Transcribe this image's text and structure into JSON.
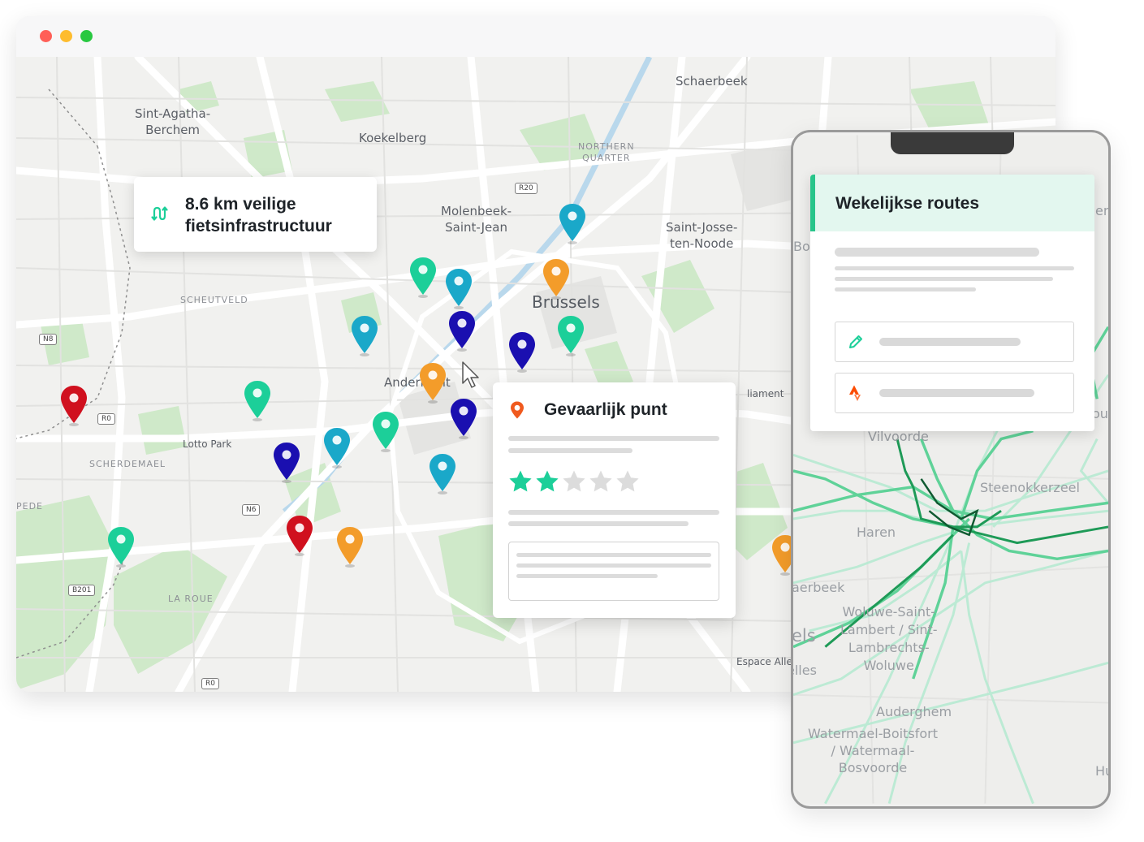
{
  "browser": {
    "controls": [
      "close",
      "minimize",
      "maximize"
    ],
    "map": {
      "labels": [
        {
          "id": "sint-agatha",
          "text": "Sint-Agatha-\nBerchem"
        },
        {
          "id": "koekelberg",
          "text": "Koekelberg"
        },
        {
          "id": "schaerbeek",
          "text": "Schaerbeek"
        },
        {
          "id": "northern-quarter",
          "text": "NORTHERN\nQUARTER"
        },
        {
          "id": "molenbeek",
          "text": "Molenbeek-\nSaint-Jean"
        },
        {
          "id": "saint-josse",
          "text": "Saint-Josse-\nten-Noode"
        },
        {
          "id": "brussels",
          "text": "Brussels"
        },
        {
          "id": "scheutveld",
          "text": "SCHEUTVELD"
        },
        {
          "id": "anderlecht",
          "text": "Anderlecht"
        },
        {
          "id": "lotto-park",
          "text": "Lotto Park"
        },
        {
          "id": "scherdemael",
          "text": "SCHERDEMAEL"
        },
        {
          "id": "la-roue",
          "text": "LA ROUE"
        },
        {
          "id": "pede",
          "text": "PEDE"
        },
        {
          "id": "espace-alle",
          "text": "Espace Alle"
        },
        {
          "id": "liament",
          "text": "liament"
        }
      ],
      "road_shields": [
        "R20",
        "N8",
        "R0",
        "N6",
        "B201",
        "R0"
      ],
      "pins": [
        {
          "color": "#f39c2a",
          "kind": "orange"
        },
        {
          "color": "#1aa8c9",
          "kind": "blue"
        },
        {
          "color": "#1ccf99",
          "kind": "green"
        },
        {
          "color": "#1a0fb0",
          "kind": "navy"
        },
        {
          "color": "#d0101e",
          "kind": "red"
        }
      ]
    },
    "km_card": {
      "line1": "8.6 km veilige",
      "line2": "fietsinfrastructuur",
      "icon": "route-icon",
      "accent": "#1ccf99"
    },
    "danger_card": {
      "title": "Gevaarlijk punt",
      "icon": "location-pin-icon",
      "icon_color": "#f05a1e",
      "rating": 2,
      "rating_max": 5,
      "star_on": "#1ccf99",
      "star_off": "#dcdcdc"
    }
  },
  "phone": {
    "card_title": "Wekelijkse routes",
    "accent": "#27c58a",
    "rows": [
      {
        "icon": "pencil-icon",
        "icon_color": "#1ccf99"
      },
      {
        "icon": "strava-icon",
        "icon_color": "#fc4c02"
      }
    ],
    "labels": [
      {
        "id": "vilvoorde",
        "text": "Vilvoorde"
      },
      {
        "id": "steenokkerzeel",
        "text": "Steenokkerzeel"
      },
      {
        "id": "haren",
        "text": "Haren"
      },
      {
        "id": "schaerbeek-p",
        "text": "aerbeek"
      },
      {
        "id": "woluwe-sl",
        "text": "Woluwe-Saint-\nLambert / Sint-\nLambrechts-\nWoluwe"
      },
      {
        "id": "els",
        "text": "els"
      },
      {
        "id": "elles",
        "text": "elles"
      },
      {
        "id": "auderghem",
        "text": "Auderghem"
      },
      {
        "id": "watermael",
        "text": "Watermael-Boitsfort\n/ Watermaal-\nBosvoorde"
      },
      {
        "id": "hu",
        "text": "Hu"
      },
      {
        "id": "en",
        "text": "en"
      },
      {
        "id": "bo",
        "text": "Bo"
      },
      {
        "id": "ou",
        "text": "ou"
      }
    ]
  }
}
